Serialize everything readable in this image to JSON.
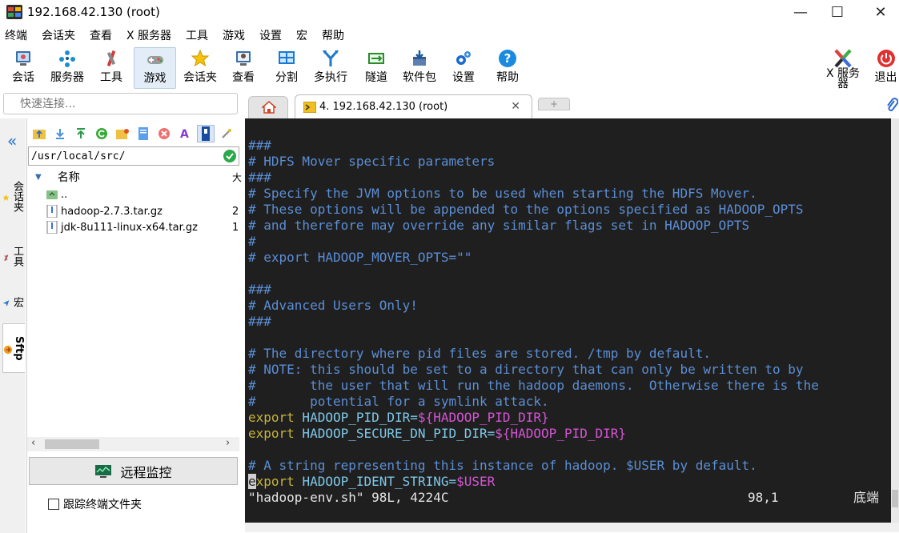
{
  "window": {
    "title": "192.168.42.130 (root)",
    "minimize": "—",
    "maximize": "☐",
    "close": "✕"
  },
  "menu": [
    "终端",
    "会话夹",
    "查看",
    "X 服务器",
    "工具",
    "游戏",
    "设置",
    "宏",
    "帮助"
  ],
  "toolbar": {
    "items": [
      {
        "label": "会话",
        "icon": "session-icon"
      },
      {
        "label": "服务器",
        "icon": "servers-icon"
      },
      {
        "label": "工具",
        "icon": "tools-icon"
      },
      {
        "label": "游戏",
        "icon": "games-icon"
      },
      {
        "label": "会话夹",
        "icon": "star-icon"
      },
      {
        "label": "查看",
        "icon": "view-icon"
      },
      {
        "label": "分割",
        "icon": "split-icon"
      },
      {
        "label": "多执行",
        "icon": "multiexec-icon"
      },
      {
        "label": "隧道",
        "icon": "tunnel-icon"
      },
      {
        "label": "软件包",
        "icon": "packages-icon"
      },
      {
        "label": "设置",
        "icon": "settings-icon"
      },
      {
        "label": "帮助",
        "icon": "help-icon"
      }
    ],
    "xserver_label_1": "X 服务",
    "xserver_label_2": "器",
    "exit_label": "退出"
  },
  "quick_connect": {
    "placeholder": "快速连接..."
  },
  "tabs": {
    "session_label": "4. 192.168.42.130 (root)",
    "close": "✕",
    "new_tab": "+"
  },
  "side_tabs": {
    "collapse": "«",
    "sessions": "会话夹",
    "tools": "工具",
    "macros": "宏",
    "sftp": "Sftp"
  },
  "sftp": {
    "path": "/usr/local/src/",
    "column_name": "名称",
    "column_size": "大",
    "files": [
      {
        "name": "..",
        "size": "",
        "type": "parent"
      },
      {
        "name": "hadoop-2.7.3.tar.gz",
        "size": "2",
        "type": "file"
      },
      {
        "name": "jdk-8u111-linux-x64.tar.gz",
        "size": "1",
        "type": "file"
      }
    ],
    "remote_monitor": "远程监控",
    "follow_folder": "跟踪终端文件夹"
  },
  "terminal": {
    "lines": [
      {
        "parts": [
          {
            "t": "###",
            "c": "c-com"
          }
        ]
      },
      {
        "parts": [
          {
            "t": "# HDFS Mover specific parameters",
            "c": "c-com"
          }
        ]
      },
      {
        "parts": [
          {
            "t": "###",
            "c": "c-com"
          }
        ]
      },
      {
        "parts": [
          {
            "t": "# Specify the JVM options to be used when starting the HDFS Mover.",
            "c": "c-com"
          }
        ]
      },
      {
        "parts": [
          {
            "t": "# These options will be appended to the options specified as HADOOP_OPTS",
            "c": "c-com"
          }
        ]
      },
      {
        "parts": [
          {
            "t": "# and therefore may override any similar flags set in HADOOP_OPTS",
            "c": "c-com"
          }
        ]
      },
      {
        "parts": [
          {
            "t": "#",
            "c": "c-com"
          }
        ]
      },
      {
        "parts": [
          {
            "t": "# export HADOOP_MOVER_OPTS=\"\"",
            "c": "c-com"
          }
        ]
      },
      {
        "parts": []
      },
      {
        "parts": [
          {
            "t": "###",
            "c": "c-com"
          }
        ]
      },
      {
        "parts": [
          {
            "t": "# Advanced Users Only!",
            "c": "c-com"
          }
        ]
      },
      {
        "parts": [
          {
            "t": "###",
            "c": "c-com"
          }
        ]
      },
      {
        "parts": []
      },
      {
        "parts": [
          {
            "t": "# The directory where pid files are stored. /tmp by default.",
            "c": "c-com"
          }
        ]
      },
      {
        "parts": [
          {
            "t": "# NOTE: this should be set to a directory that can only be written to by",
            "c": "c-com"
          }
        ]
      },
      {
        "parts": [
          {
            "t": "#       the user that will run the hadoop daemons.  Otherwise there is the",
            "c": "c-com"
          }
        ]
      },
      {
        "parts": [
          {
            "t": "#       potential for a symlink attack.",
            "c": "c-com"
          }
        ]
      },
      {
        "parts": [
          {
            "t": "export",
            "c": "c-kw"
          },
          {
            "t": " HADOOP_PID_DIR=",
            "c": "c-txt"
          },
          {
            "t": "${HADOOP_PID_DIR}",
            "c": "c-var"
          }
        ]
      },
      {
        "parts": [
          {
            "t": "export",
            "c": "c-kw"
          },
          {
            "t": " HADOOP_SECURE_DN_PID_DIR=",
            "c": "c-txt"
          },
          {
            "t": "${HADOOP_PID_DIR}",
            "c": "c-var"
          }
        ]
      },
      {
        "parts": []
      },
      {
        "parts": [
          {
            "t": "# A string representing this instance of hadoop. $USER by default.",
            "c": "c-com"
          }
        ]
      },
      {
        "parts": [
          {
            "t": "e",
            "c": "cursor"
          },
          {
            "t": "xport",
            "c": "c-kw"
          },
          {
            "t": " HADOOP_IDENT_STRING=",
            "c": "c-txt"
          },
          {
            "t": "$USER",
            "c": "c-var"
          }
        ]
      }
    ],
    "status_file": "\"hadoop-env.sh\" 98L, 4224C",
    "status_pos": "98,1",
    "status_end": "底端"
  }
}
